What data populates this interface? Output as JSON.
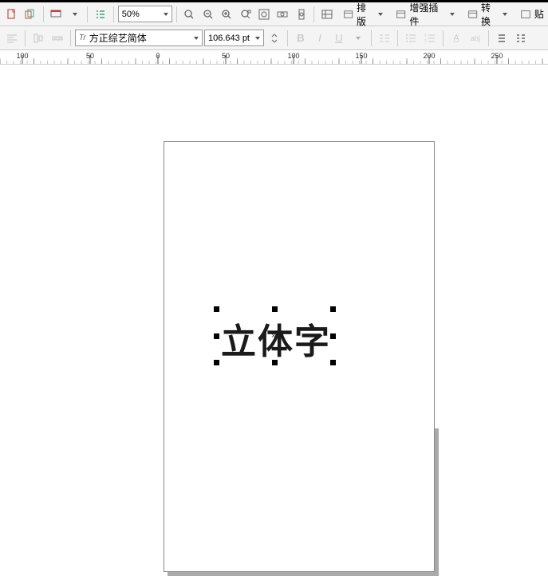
{
  "toolbar1": {
    "zoom_value": "50%",
    "menus": {
      "layout": "排版",
      "enhance": "增强插件",
      "convert": "转换",
      "paste": "贴"
    }
  },
  "toolbar2": {
    "font_prefix_icon": "Tr",
    "font_name": "方正综艺简体",
    "font_size": "106.643 pt"
  },
  "ruler": {
    "ticks": [
      "100",
      "50",
      "0",
      "50",
      "100",
      "150",
      "200",
      "250"
    ]
  },
  "canvas": {
    "text_content": "立体字"
  }
}
